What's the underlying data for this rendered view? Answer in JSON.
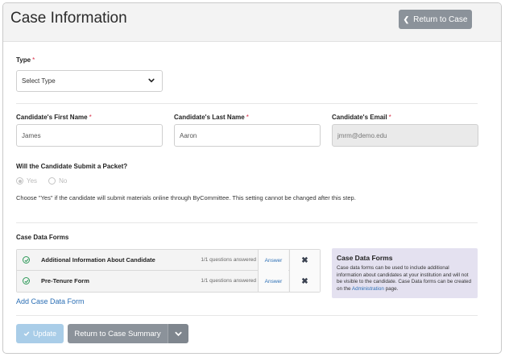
{
  "header": {
    "title": "Case Information",
    "return_label": "Return to Case"
  },
  "type_field": {
    "label": "Type",
    "value": "Select Type"
  },
  "first_name": {
    "label": "Candidate's First Name",
    "value": "James"
  },
  "last_name": {
    "label": "Candidate's Last Name",
    "value": "Aaron"
  },
  "email": {
    "label": "Candidate's Email",
    "value": "jmrm@demo.edu"
  },
  "packet": {
    "question": "Will the Candidate Submit a Packet?",
    "options": [
      "Yes",
      "No"
    ],
    "selected": "Yes",
    "help": "Choose \"Yes\" if the candidate will submit materials online through ByCommittee. This setting cannot be changed after this step."
  },
  "case_forms": {
    "heading": "Case Data Forms",
    "rows": [
      {
        "name": "Additional Information About Candidate",
        "count": "1/1 questions answered",
        "action": "Answer"
      },
      {
        "name": "Pre-Tenure Form",
        "count": "1/1 questions answered",
        "action": "Answer"
      }
    ],
    "add_label": "Add Case Data Form"
  },
  "info_box": {
    "title": "Case Data Forms",
    "text_before": "Case data forms can be used to include additional information about candidates at your institution and will not be visible to the candidate. Case Data forms can be created on the ",
    "link": "Administration",
    "text_after": " page."
  },
  "footer": {
    "update_label": "Update",
    "summary_label": "Return to Case Summary"
  },
  "colors": {
    "accent_link": "#2c6fb5",
    "required": "#d9304a",
    "primary_disabled": "#a9cde8",
    "secondary": "#8b929a",
    "check_green": "#2f9a5a",
    "info_bg": "#e4e1f0"
  }
}
